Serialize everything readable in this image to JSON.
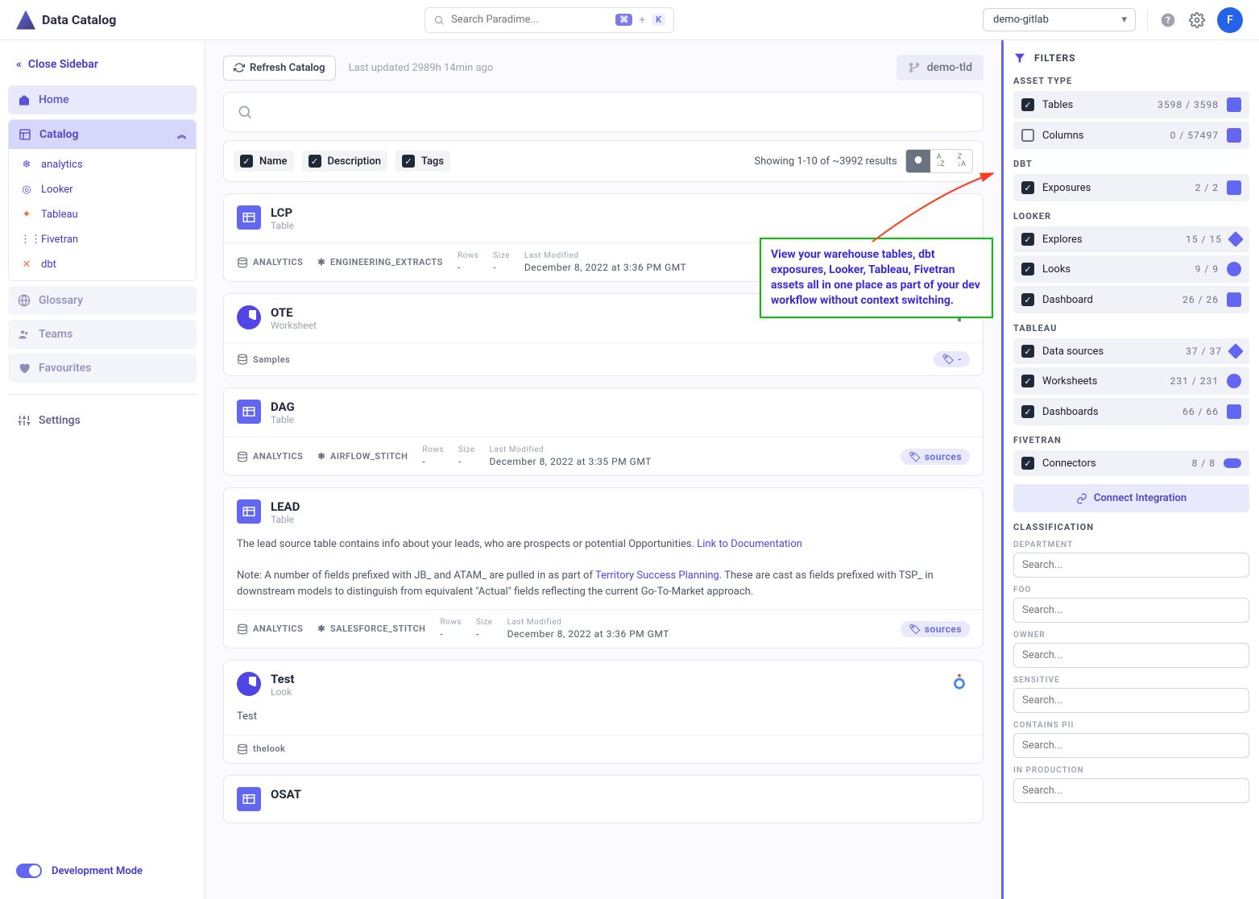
{
  "app_name": "Data Catalog",
  "search": {
    "placeholder": "Search Paradime...",
    "kbd1": "⌘",
    "kbd2": "K"
  },
  "workspace": "demo-gitlab",
  "avatar_letter": "F",
  "sidebar": {
    "close": "Close Sidebar",
    "home": "Home",
    "catalog": "Catalog",
    "subs": [
      "analytics",
      "Looker",
      "Tableau",
      "Fivetran",
      "dbt"
    ],
    "glossary": "Glossary",
    "teams": "Teams",
    "favourites": "Favourites",
    "settings": "Settings",
    "dev_mode": "Development Mode"
  },
  "main": {
    "refresh": "Refresh Catalog",
    "last_updated": "Last updated 2989h 14min ago",
    "env": "demo-tld",
    "checks": {
      "name": "Name",
      "description": "Description",
      "tags": "Tags"
    },
    "result_count": "Showing 1-10 of ~3992 results"
  },
  "cards": [
    {
      "title": "LCP",
      "subtitle": "Table",
      "foot_db": "ANALYTICS",
      "foot_schema": "ENGINEERING_EXTRACTS",
      "rows": "-",
      "size": "-",
      "last_modified": "December 8, 2022 at 3:36 PM GMT",
      "source_icon": "snowflake",
      "type": "table"
    },
    {
      "title": "OTE",
      "subtitle": "Worksheet",
      "foot_db": "Samples",
      "type": "pie",
      "source_icon": "tableau",
      "tag": "-"
    },
    {
      "title": "DAG",
      "subtitle": "Table",
      "foot_db": "ANALYTICS",
      "foot_schema": "AIRFLOW_STITCH",
      "rows": "-",
      "size": "-",
      "last_modified": "December 8, 2022 at 3:35 PM GMT",
      "source_icon": "snowflake",
      "type": "table",
      "tag": "sources"
    },
    {
      "title": "LEAD",
      "subtitle": "Table",
      "type": "table",
      "source_icon": "snowflake",
      "desc1": "The lead source table contains info about your leads, who are prospects or potential Opportunities. ",
      "desc_link1": "Link to Documentation",
      "desc2": "Note: A number of fields prefixed with JB_ and ATAM_ are pulled in as part of ",
      "desc_link2": "Territory Success Planning",
      "desc3": ". These are cast as fields prefixed with TSP_ in downstream models to distinguish from equivalent \"Actual\" fields reflecting the current Go-To-Market approach.",
      "foot_db": "ANALYTICS",
      "foot_schema": "SALESFORCE_STITCH",
      "rows": "-",
      "size": "-",
      "last_modified": "December 8, 2022 at 3:36 PM GMT",
      "tag": "sources"
    },
    {
      "title": "Test",
      "subtitle": "Look",
      "type": "pie",
      "source_icon": "looker",
      "desc_plain": "Test",
      "foot_db": "thelook"
    },
    {
      "title": "OSAT",
      "subtitle": "",
      "type": "table"
    }
  ],
  "annotation": "View your warehouse tables, dbt exposures, Looker, Tableau, Fivetran assets all in one place as part of your dev workflow without context switching.",
  "filters": {
    "title": "FILTERS",
    "groups": [
      {
        "label": "ASSET TYPE",
        "rows": [
          {
            "name": "Tables",
            "count": "3598 / 3598",
            "checked": true,
            "icon": "square"
          },
          {
            "name": "Columns",
            "count": "0 / 57497",
            "checked": false,
            "icon": "square"
          }
        ]
      },
      {
        "label": "DBT",
        "rows": [
          {
            "name": "Exposures",
            "count": "2 / 2",
            "checked": true,
            "icon": "grid"
          }
        ]
      },
      {
        "label": "LOOKER",
        "rows": [
          {
            "name": "Explores",
            "count": "15 / 15",
            "checked": true,
            "icon": "diamond"
          },
          {
            "name": "Looks",
            "count": "9 / 9",
            "checked": true,
            "icon": "circle"
          },
          {
            "name": "Dashboard",
            "count": "26 / 26",
            "checked": true,
            "icon": "square"
          }
        ]
      },
      {
        "label": "TABLEAU",
        "rows": [
          {
            "name": "Data sources",
            "count": "37 / 37",
            "checked": true,
            "icon": "diamond"
          },
          {
            "name": "Worksheets",
            "count": "231 / 231",
            "checked": true,
            "icon": "circle"
          },
          {
            "name": "Dashboards",
            "count": "66 / 66",
            "checked": true,
            "icon": "square"
          }
        ]
      },
      {
        "label": "FIVETRAN",
        "rows": [
          {
            "name": "Connectors",
            "count": "8 / 8",
            "checked": true,
            "icon": "pill"
          }
        ]
      }
    ],
    "connect": "Connect Integration",
    "classification": "CLASSIFICATION",
    "class_fields": [
      "DEPARTMENT",
      "FOO",
      "OWNER",
      "SENSITIVE",
      "CONTAINS PII",
      "IN PRODUCTION"
    ],
    "search_ph": "Search..."
  }
}
